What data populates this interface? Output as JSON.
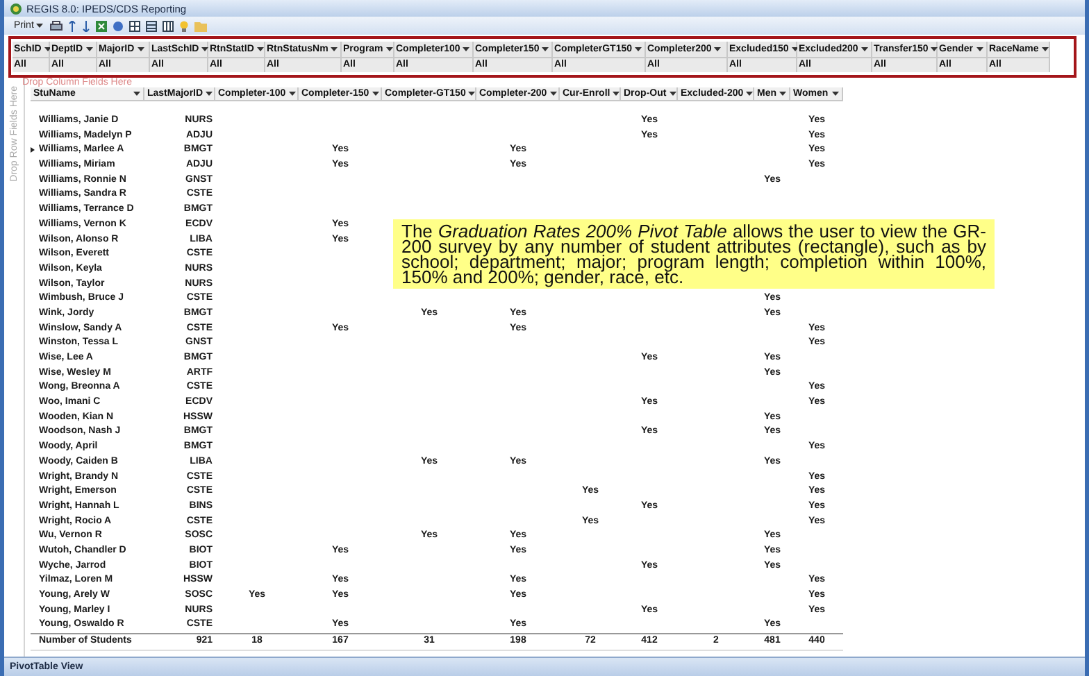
{
  "window": {
    "title": "REGIS 8.0: IPEDS/CDS Reporting"
  },
  "toolbar": {
    "print_label": "Print"
  },
  "filter_fields": [
    {
      "label": "SchID",
      "value": "All"
    },
    {
      "label": "DeptID",
      "value": "All"
    },
    {
      "label": "MajorID",
      "value": "All"
    },
    {
      "label": "LastSchID",
      "value": "All"
    },
    {
      "label": "RtnStatID",
      "value": "All"
    },
    {
      "label": "RtnStatusNm",
      "value": "All"
    },
    {
      "label": "Program",
      "value": "All"
    },
    {
      "label": "Completer100",
      "value": "All"
    },
    {
      "label": "Completer150",
      "value": "All"
    },
    {
      "label": "CompleterGT150",
      "value": "All"
    },
    {
      "label": "Completer200",
      "value": "All"
    },
    {
      "label": "Excluded150",
      "value": "All"
    },
    {
      "label": "Excluded200",
      "value": "All"
    },
    {
      "label": "Transfer150",
      "value": "All"
    },
    {
      "label": "Gender",
      "value": "All"
    },
    {
      "label": "RaceName",
      "value": "All"
    }
  ],
  "drop_column_hint": "Drop Column Fields Here",
  "drop_row_hint": "Drop Row Fields Here",
  "table": {
    "columns": [
      "StuName",
      "LastMajorID",
      "Completer-100",
      "Completer-150",
      "Completer-GT150",
      "Completer-200",
      "Cur-Enroll",
      "Drop-Out",
      "Excluded-200",
      "Men",
      "Women"
    ],
    "rows": [
      {
        "selected": false,
        "cells": [
          "Williams, Janie D",
          "NURS",
          null,
          null,
          null,
          null,
          null,
          "Yes",
          null,
          null,
          "Yes"
        ]
      },
      {
        "selected": false,
        "cells": [
          "Williams, Madelyn P",
          "ADJU",
          null,
          null,
          null,
          null,
          null,
          "Yes",
          null,
          null,
          "Yes"
        ]
      },
      {
        "selected": true,
        "cells": [
          "Williams, Marlee A",
          "BMGT",
          null,
          "Yes",
          null,
          "Yes",
          null,
          null,
          null,
          null,
          "Yes"
        ]
      },
      {
        "selected": false,
        "cells": [
          "Williams, Miriam",
          "ADJU",
          null,
          "Yes",
          null,
          "Yes",
          null,
          null,
          null,
          null,
          "Yes"
        ]
      },
      {
        "selected": false,
        "cells": [
          "Williams, Ronnie N",
          "GNST",
          null,
          null,
          null,
          null,
          null,
          null,
          null,
          "Yes",
          null
        ]
      },
      {
        "selected": false,
        "cells": [
          "Williams, Sandra R",
          "CSTE",
          null,
          null,
          null,
          null,
          null,
          null,
          null,
          null,
          null
        ]
      },
      {
        "selected": false,
        "cells": [
          "Williams, Terrance D",
          "BMGT",
          null,
          null,
          null,
          null,
          null,
          null,
          null,
          null,
          null
        ]
      },
      {
        "selected": false,
        "cells": [
          "Williams, Vernon K",
          "ECDV",
          null,
          "Yes",
          null,
          null,
          null,
          null,
          null,
          null,
          null
        ]
      },
      {
        "selected": false,
        "cells": [
          "Wilson, Alonso R",
          "LIBA",
          null,
          "Yes",
          null,
          null,
          null,
          null,
          null,
          null,
          null
        ]
      },
      {
        "selected": false,
        "cells": [
          "Wilson, Everett",
          "CSTE",
          null,
          null,
          null,
          null,
          null,
          null,
          null,
          null,
          null
        ]
      },
      {
        "selected": false,
        "cells": [
          "Wilson, Keyla",
          "NURS",
          null,
          null,
          null,
          null,
          null,
          null,
          null,
          null,
          null
        ]
      },
      {
        "selected": false,
        "cells": [
          "Wilson, Taylor",
          "NURS",
          null,
          null,
          null,
          null,
          null,
          null,
          null,
          null,
          null
        ]
      },
      {
        "selected": false,
        "cells": [
          "Wimbush, Bruce J",
          "CSTE",
          null,
          null,
          null,
          null,
          null,
          null,
          null,
          "Yes",
          null
        ]
      },
      {
        "selected": false,
        "cells": [
          "Wink, Jordy",
          "BMGT",
          null,
          null,
          "Yes",
          "Yes",
          null,
          null,
          null,
          "Yes",
          null
        ]
      },
      {
        "selected": false,
        "cells": [
          "Winslow, Sandy A",
          "CSTE",
          null,
          "Yes",
          null,
          "Yes",
          null,
          null,
          null,
          null,
          "Yes"
        ]
      },
      {
        "selected": false,
        "cells": [
          "Winston, Tessa L",
          "GNST",
          null,
          null,
          null,
          null,
          null,
          null,
          null,
          null,
          "Yes"
        ]
      },
      {
        "selected": false,
        "cells": [
          "Wise, Lee A",
          "BMGT",
          null,
          null,
          null,
          null,
          null,
          "Yes",
          null,
          "Yes",
          null
        ]
      },
      {
        "selected": false,
        "cells": [
          "Wise, Wesley M",
          "ARTF",
          null,
          null,
          null,
          null,
          null,
          null,
          null,
          "Yes",
          null
        ]
      },
      {
        "selected": false,
        "cells": [
          "Wong, Breonna A",
          "CSTE",
          null,
          null,
          null,
          null,
          null,
          null,
          null,
          null,
          "Yes"
        ]
      },
      {
        "selected": false,
        "cells": [
          "Woo, Imani C",
          "ECDV",
          null,
          null,
          null,
          null,
          null,
          "Yes",
          null,
          null,
          "Yes"
        ]
      },
      {
        "selected": false,
        "cells": [
          "Wooden, Kian N",
          "HSSW",
          null,
          null,
          null,
          null,
          null,
          null,
          null,
          "Yes",
          null
        ]
      },
      {
        "selected": false,
        "cells": [
          "Woodson, Nash J",
          "BMGT",
          null,
          null,
          null,
          null,
          null,
          "Yes",
          null,
          "Yes",
          null
        ]
      },
      {
        "selected": false,
        "cells": [
          "Woody, April",
          "BMGT",
          null,
          null,
          null,
          null,
          null,
          null,
          null,
          null,
          "Yes"
        ]
      },
      {
        "selected": false,
        "cells": [
          "Woody, Caiden B",
          "LIBA",
          null,
          null,
          "Yes",
          "Yes",
          null,
          null,
          null,
          "Yes",
          null
        ]
      },
      {
        "selected": false,
        "cells": [
          "Wright, Brandy N",
          "CSTE",
          null,
          null,
          null,
          null,
          null,
          null,
          null,
          null,
          "Yes"
        ]
      },
      {
        "selected": false,
        "cells": [
          "Wright, Emerson",
          "CSTE",
          null,
          null,
          null,
          null,
          "Yes",
          null,
          null,
          null,
          "Yes"
        ]
      },
      {
        "selected": false,
        "cells": [
          "Wright, Hannah L",
          "BINS",
          null,
          null,
          null,
          null,
          null,
          "Yes",
          null,
          null,
          "Yes"
        ]
      },
      {
        "selected": false,
        "cells": [
          "Wright, Rocio A",
          "CSTE",
          null,
          null,
          null,
          null,
          "Yes",
          null,
          null,
          null,
          "Yes"
        ]
      },
      {
        "selected": false,
        "cells": [
          "Wu, Vernon R",
          "SOSC",
          null,
          null,
          "Yes",
          "Yes",
          null,
          null,
          null,
          "Yes",
          null
        ]
      },
      {
        "selected": false,
        "cells": [
          "Wutoh, Chandler D",
          "BIOT",
          null,
          "Yes",
          null,
          "Yes",
          null,
          null,
          null,
          "Yes",
          null
        ]
      },
      {
        "selected": false,
        "cells": [
          "Wyche, Jarrod",
          "BIOT",
          null,
          null,
          null,
          null,
          null,
          "Yes",
          null,
          "Yes",
          null
        ]
      },
      {
        "selected": false,
        "cells": [
          "Yilmaz, Loren M",
          "HSSW",
          null,
          "Yes",
          null,
          "Yes",
          null,
          null,
          null,
          null,
          "Yes"
        ]
      },
      {
        "selected": false,
        "cells": [
          "Young, Arely W",
          "SOSC",
          "Yes",
          "Yes",
          null,
          "Yes",
          null,
          null,
          null,
          null,
          "Yes"
        ]
      },
      {
        "selected": false,
        "cells": [
          "Young, Marley I",
          "NURS",
          null,
          null,
          null,
          null,
          null,
          "Yes",
          null,
          null,
          "Yes"
        ]
      },
      {
        "selected": false,
        "cells": [
          "Young, Oswaldo R",
          "CSTE",
          null,
          "Yes",
          null,
          "Yes",
          null,
          null,
          null,
          "Yes",
          null
        ]
      }
    ],
    "total": [
      "Number of Students",
      "921",
      "18",
      "167",
      "31",
      "198",
      "72",
      "412",
      "2",
      "481",
      "440"
    ]
  },
  "callout": {
    "text": "The *Graduation Rates 200% Pivot Table* allows the user to view the GR-200 survey by any number of student attributes (rectangle), such as by school; department; major; program length; completion within 100%, 150% and 200%; gender, race, etc."
  },
  "status_bar": {
    "text": "PivotTable View"
  }
}
